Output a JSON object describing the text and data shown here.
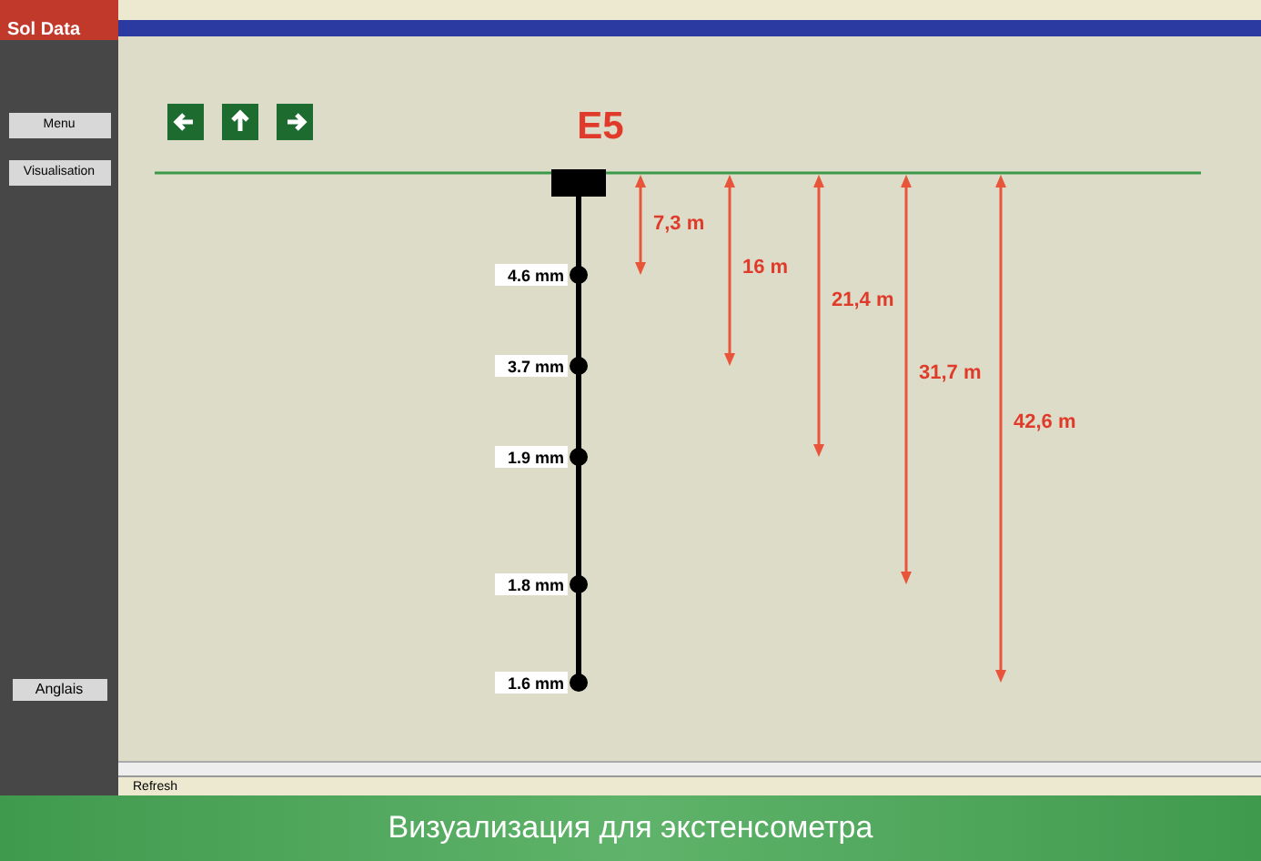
{
  "app": {
    "logo": "Sol Data",
    "sidebar_buttons": [
      {
        "label": "Menu"
      },
      {
        "label": "Visualisation"
      }
    ],
    "language_button": "Anglais"
  },
  "nav_buttons": [
    {
      "kind": "left"
    },
    {
      "kind": "up"
    },
    {
      "kind": "right"
    }
  ],
  "diagram": {
    "title": "E5",
    "anchors": [
      {
        "label": "4.6 mm"
      },
      {
        "label": "3.7 mm"
      },
      {
        "label": "1.9 mm"
      },
      {
        "label": "1.8 mm"
      },
      {
        "label": "1.6 mm"
      }
    ],
    "depths": [
      {
        "label": "7,3 m"
      },
      {
        "label": "16 m"
      },
      {
        "label": "21,4 m"
      },
      {
        "label": "31,7 m"
      },
      {
        "label": "42,6 m"
      }
    ]
  },
  "status_bar": {
    "button": "Refresh"
  },
  "caption": "Визуализация для экстенсометра"
}
